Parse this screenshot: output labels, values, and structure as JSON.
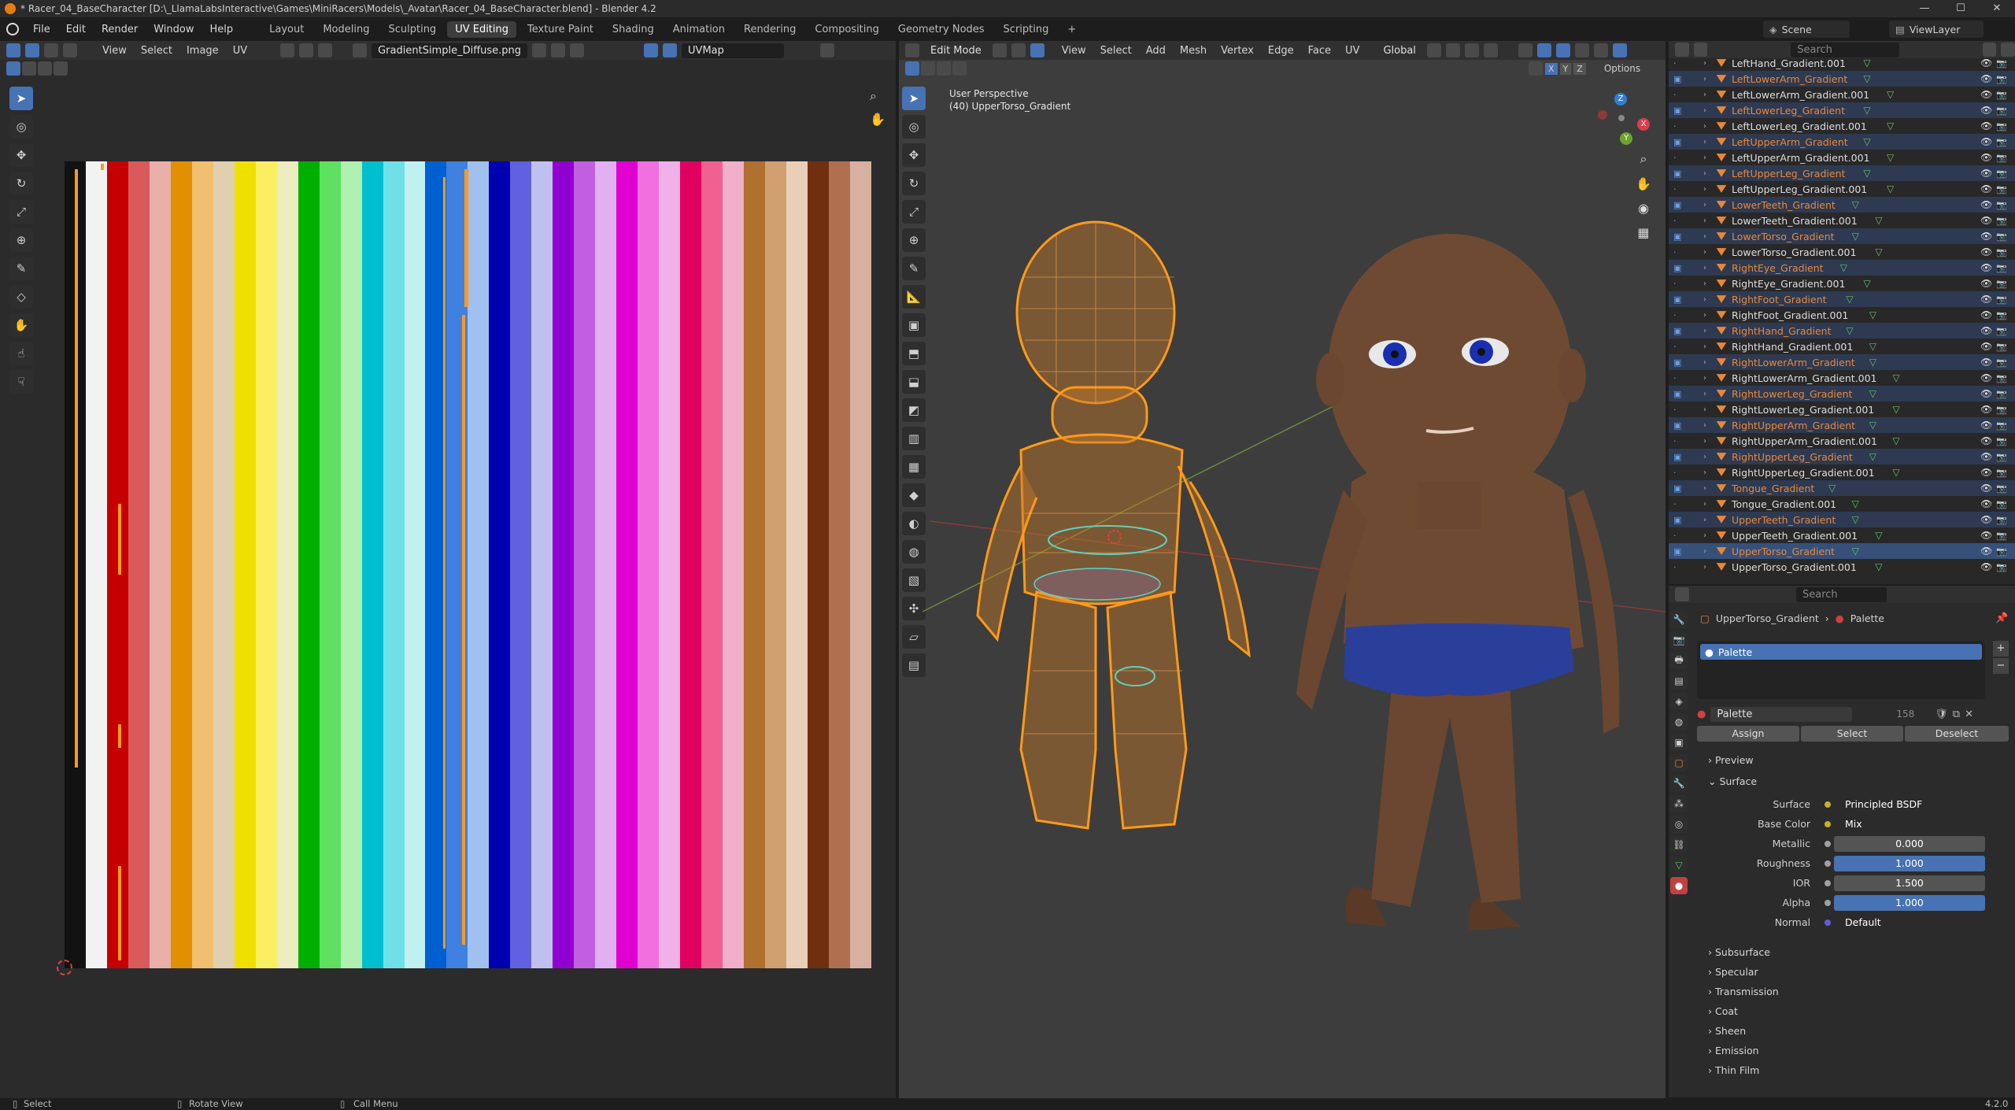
{
  "window": {
    "title": "* Racer_04_BaseCharacter [D:\\_LlamaLabsInteractive\\Games\\MiniRacers\\Models\\_Avatar\\Racer_04_BaseCharacter.blend] - Blender 4.2"
  },
  "menu": [
    "File",
    "Edit",
    "Render",
    "Window",
    "Help"
  ],
  "workspaces": [
    "Layout",
    "Modeling",
    "Sculpting",
    "UV Editing",
    "Texture Paint",
    "Shading",
    "Animation",
    "Rendering",
    "Compositing",
    "Geometry Nodes",
    "Scripting"
  ],
  "active_workspace": "UV Editing",
  "scene": {
    "name": "Scene",
    "view_layer": "ViewLayer"
  },
  "uv_editor": {
    "menus": [
      "View",
      "Select",
      "Image",
      "UV"
    ],
    "image_name": "GradientSimple_Diffuse.png",
    "uv_map": "UVMap",
    "stripe_colors": [
      "#121212",
      "#f2f2f2",
      "#c60000",
      "#d85a5a",
      "#e8b0a8",
      "#e09000",
      "#f0c070",
      "#e0d0b0",
      "#f0e000",
      "#f8f060",
      "#ececc0",
      "#00b000",
      "#60e060",
      "#b0f0b0",
      "#00c0d0",
      "#70e0e8",
      "#c0f0f0",
      "#0060d0",
      "#4080e0",
      "#a0c0f0",
      "#0000b0",
      "#6060e0",
      "#c0c0f0",
      "#9000d0",
      "#c060e0",
      "#e0b0f0",
      "#e000d0",
      "#f070e0",
      "#f0b0e8",
      "#e00060",
      "#f06090",
      "#f0b0c8",
      "#b07030",
      "#d0a070",
      "#e8d0b8",
      "#703010",
      "#b07050",
      "#d8b0a0"
    ]
  },
  "viewport": {
    "mode": "Edit Mode",
    "menus": [
      "View",
      "Select",
      "Add",
      "Mesh",
      "Vertex",
      "Edge",
      "Face",
      "UV"
    ],
    "orientation": "Global",
    "view_name": "User Perspective",
    "object_label": "(40) UpperTorso_Gradient",
    "axis": [
      "X",
      "Y",
      "Z"
    ],
    "options": "Options"
  },
  "outliner": {
    "search_placeholder": "Search",
    "items": [
      {
        "name": "LeftHand_Gradient.001",
        "state": "plain"
      },
      {
        "name": "LeftLowerArm_Gradient",
        "state": "selected"
      },
      {
        "name": "LeftLowerArm_Gradient.001",
        "state": "plain"
      },
      {
        "name": "LeftLowerLeg_Gradient",
        "state": "selected"
      },
      {
        "name": "LeftLowerLeg_Gradient.001",
        "state": "plain"
      },
      {
        "name": "LeftUpperArm_Gradient",
        "state": "selected"
      },
      {
        "name": "LeftUpperArm_Gradient.001",
        "state": "plain"
      },
      {
        "name": "LeftUpperLeg_Gradient",
        "state": "selected"
      },
      {
        "name": "LeftUpperLeg_Gradient.001",
        "state": "plain"
      },
      {
        "name": "LowerTeeth_Gradient",
        "state": "selected"
      },
      {
        "name": "LowerTeeth_Gradient.001",
        "state": "plain"
      },
      {
        "name": "LowerTorso_Gradient",
        "state": "selected"
      },
      {
        "name": "LowerTorso_Gradient.001",
        "state": "plain"
      },
      {
        "name": "RightEye_Gradient",
        "state": "selected"
      },
      {
        "name": "RightEye_Gradient.001",
        "state": "plain"
      },
      {
        "name": "RightFoot_Gradient",
        "state": "selected"
      },
      {
        "name": "RightFoot_Gradient.001",
        "state": "plain"
      },
      {
        "name": "RightHand_Gradient",
        "state": "selected"
      },
      {
        "name": "RightHand_Gradient.001",
        "state": "plain"
      },
      {
        "name": "RightLowerArm_Gradient",
        "state": "selected"
      },
      {
        "name": "RightLowerArm_Gradient.001",
        "state": "plain"
      },
      {
        "name": "RightLowerLeg_Gradient",
        "state": "selected"
      },
      {
        "name": "RightLowerLeg_Gradient.001",
        "state": "plain"
      },
      {
        "name": "RightUpperArm_Gradient",
        "state": "selected"
      },
      {
        "name": "RightUpperArm_Gradient.001",
        "state": "plain"
      },
      {
        "name": "RightUpperLeg_Gradient",
        "state": "selected"
      },
      {
        "name": "RightUpperLeg_Gradient.001",
        "state": "plain"
      },
      {
        "name": "Tongue_Gradient",
        "state": "selected"
      },
      {
        "name": "Tongue_Gradient.001",
        "state": "plain"
      },
      {
        "name": "UpperTeeth_Gradient",
        "state": "selected"
      },
      {
        "name": "UpperTeeth_Gradient.001",
        "state": "plain"
      },
      {
        "name": "UpperTorso_Gradient",
        "state": "active"
      },
      {
        "name": "UpperTorso_Gradient.001",
        "state": "plain"
      }
    ]
  },
  "properties": {
    "search_placeholder": "Search",
    "breadcrumb_object": "UpperTorso_Gradient",
    "breadcrumb_material": "Palette",
    "slot_name": "Palette",
    "material_name": "Palette",
    "user_count": "158",
    "buttons": {
      "assign": "Assign",
      "select": "Select",
      "deselect": "Deselect"
    },
    "preview": "Preview",
    "surface_header": "Surface",
    "fields": [
      {
        "label": "Surface",
        "value": "Principled BSDF",
        "kind": "dark"
      },
      {
        "label": "Base Color",
        "value": "Mix",
        "kind": "dark"
      },
      {
        "label": "Metallic",
        "value": "0.000",
        "kind": "gray"
      },
      {
        "label": "Roughness",
        "value": "1.000",
        "kind": "blue"
      },
      {
        "label": "IOR",
        "value": "1.500",
        "kind": "gray"
      },
      {
        "label": "Alpha",
        "value": "1.000",
        "kind": "blue"
      },
      {
        "label": "Normal",
        "value": "Default",
        "kind": "dark"
      }
    ],
    "subsections": [
      "Subsurface",
      "Specular",
      "Transmission",
      "Coat",
      "Sheen",
      "Emission",
      "Thin Film"
    ]
  },
  "statusbar": {
    "select": "Select",
    "rotate": "Rotate View",
    "menu": "Call Menu",
    "version": "4.2.0"
  }
}
